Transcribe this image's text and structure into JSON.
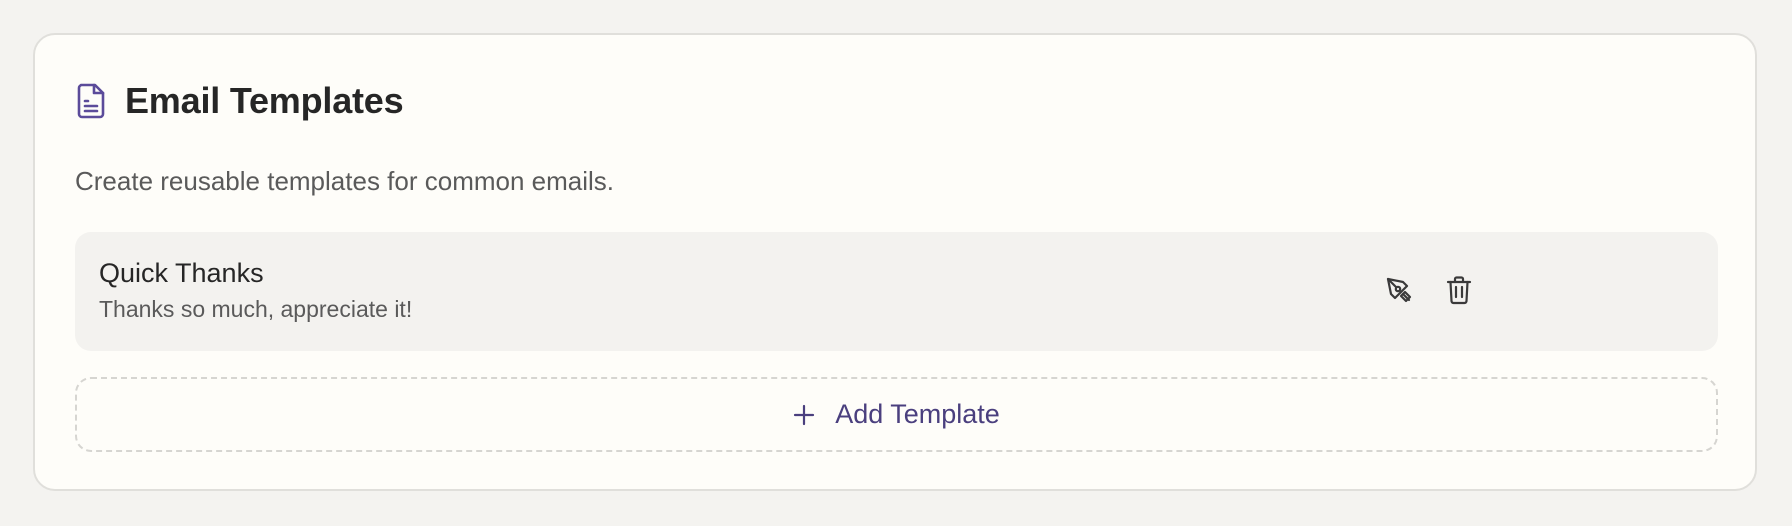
{
  "section": {
    "title": "Email Templates",
    "icon": "document-icon",
    "subtitle": "Create reusable templates for common emails."
  },
  "templates": [
    {
      "name": "Quick Thanks",
      "body": "Thanks so much, appreciate it!",
      "edit_icon": "pen-icon",
      "delete_icon": "trash-icon"
    }
  ],
  "add_button": {
    "icon": "plus-icon",
    "label": "Add Template"
  },
  "colors": {
    "accent": "#4a3f7e",
    "icon_purple": "#5b4b9a",
    "background": "#f4f3f0",
    "card": "#fefdf9",
    "item": "#f3f2ef"
  }
}
